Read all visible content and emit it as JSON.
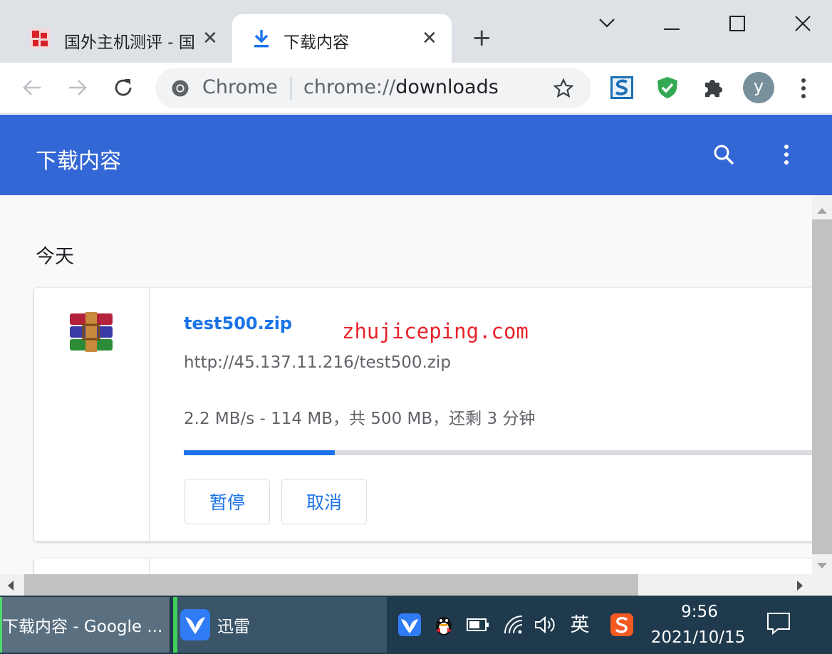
{
  "tabs": [
    {
      "title": "国外主机测评 - 国",
      "close_glyph": "✕"
    },
    {
      "title": "下载内容",
      "close_glyph": "✕"
    }
  ],
  "new_tab_glyph": "+",
  "window_controls": {
    "dropdown": "⌄",
    "minimize": "—",
    "maximize": "☐",
    "close": "✕"
  },
  "omnibox": {
    "site_label": "Chrome",
    "url_scheme": "chrome://",
    "url_path": "downloads"
  },
  "profile_initial": "y",
  "header": {
    "title": "下载内容"
  },
  "section_date": "今天",
  "download": {
    "file_name": "test500.zip",
    "url": "http://45.137.11.216/test500.zip",
    "status": "2.2 MB/s - 114 MB，共 500 MB，还剩 3 分钟",
    "progress": 0.228,
    "pause_label": "暂停",
    "cancel_label": "取消"
  },
  "watermark": "zhujiceping.com",
  "taskbar": {
    "chrome_item": "下载内容 - Google ...",
    "xunlei_item": "迅雷",
    "ime_label": "英",
    "time": "9:56",
    "date": "2021/10/15"
  },
  "colors": {
    "header_blue": "#3367d6",
    "link_blue": "#1a73e8",
    "shield_green": "#34a853",
    "watermark_red": "#e8232b",
    "taskbar_bg": "#1f3a4d"
  },
  "icons": [
    "chrome-logo-icon",
    "download-arrow-icon",
    "back-arrow-icon",
    "forward-arrow-icon",
    "reload-icon",
    "star-icon",
    "s-extension-icon",
    "shield-extension-icon",
    "puzzle-icon",
    "kebab-menu-icon",
    "search-icon",
    "winrar-file-icon",
    "xunlei-bird-icon",
    "qq-penguin-icon",
    "battery-icon",
    "wifi-icon",
    "volume-icon",
    "sogou-icon",
    "notification-icon"
  ]
}
